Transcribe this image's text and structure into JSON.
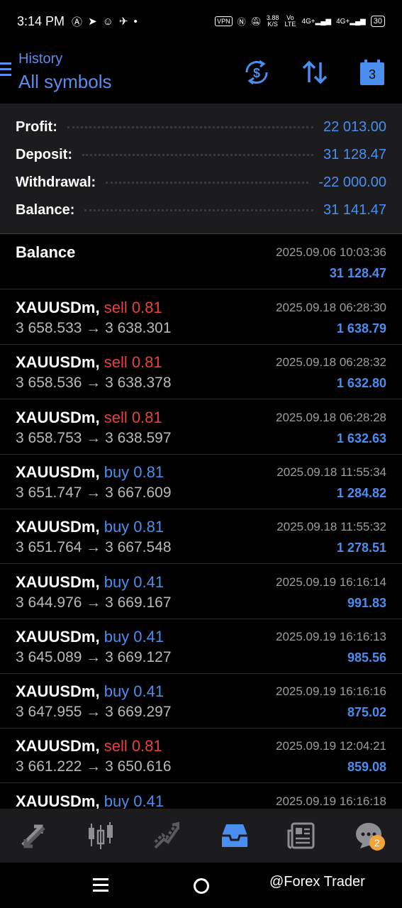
{
  "status_bar": {
    "time": "3:14 PM",
    "vpn": "VPN",
    "speed_value": "3.88",
    "speed_unit": "K/S",
    "volte": "Vo LTE",
    "net1": "4G+",
    "net2": "4G+",
    "battery": "30"
  },
  "header": {
    "subtitle": "History",
    "title": "All symbols",
    "calendar_day": "3"
  },
  "summary": [
    {
      "label": "Profit:",
      "value": "22 013.00"
    },
    {
      "label": "Deposit:",
      "value": "31 128.47"
    },
    {
      "label": "Withdrawal:",
      "value": "-22 000.00"
    },
    {
      "label": "Balance:",
      "value": "31 141.47"
    }
  ],
  "balance_entry": {
    "label": "Balance",
    "time": "2025.09.06 10:03:36",
    "amount": "31 128.47"
  },
  "deals": [
    {
      "symbol": "XAUUSDm,",
      "type": "sell 0.81",
      "side": "sell",
      "prices": "3 658.533 → 3 638.301",
      "time": "2025.09.18 06:28:30",
      "profit": "1 638.79"
    },
    {
      "symbol": "XAUUSDm,",
      "type": "sell 0.81",
      "side": "sell",
      "prices": "3 658.536 → 3 638.378",
      "time": "2025.09.18 06:28:32",
      "profit": "1 632.80"
    },
    {
      "symbol": "XAUUSDm,",
      "type": "sell 0.81",
      "side": "sell",
      "prices": "3 658.753 → 3 638.597",
      "time": "2025.09.18 06:28:28",
      "profit": "1 632.63"
    },
    {
      "symbol": "XAUUSDm,",
      "type": "buy 0.81",
      "side": "buy",
      "prices": "3 651.747 → 3 667.609",
      "time": "2025.09.18 11:55:34",
      "profit": "1 284.82"
    },
    {
      "symbol": "XAUUSDm,",
      "type": "buy 0.81",
      "side": "buy",
      "prices": "3 651.764 → 3 667.548",
      "time": "2025.09.18 11:55:32",
      "profit": "1 278.51"
    },
    {
      "symbol": "XAUUSDm,",
      "type": "buy 0.41",
      "side": "buy",
      "prices": "3 644.976 → 3 669.167",
      "time": "2025.09.19 16:16:14",
      "profit": "991.83"
    },
    {
      "symbol": "XAUUSDm,",
      "type": "buy 0.41",
      "side": "buy",
      "prices": "3 645.089 → 3 669.127",
      "time": "2025.09.19 16:16:13",
      "profit": "985.56"
    },
    {
      "symbol": "XAUUSDm,",
      "type": "buy 0.41",
      "side": "buy",
      "prices": "3 647.955 → 3 669.297",
      "time": "2025.09.19 16:16:16",
      "profit": "875.02"
    },
    {
      "symbol": "XAUUSDm,",
      "type": "sell 0.81",
      "side": "sell",
      "prices": "3 661.222 → 3 650.616",
      "time": "2025.09.19 12:04:21",
      "profit": "859.08"
    },
    {
      "symbol": "XAUUSDm,",
      "type": "buy 0.41",
      "side": "buy",
      "prices": "",
      "time": "2025.09.19 16:16:18",
      "profit": ""
    }
  ],
  "tabbar": {
    "icons": [
      "quotes-icon",
      "chart-icon",
      "trade-icon",
      "history-icon",
      "news-icon",
      "messages-icon"
    ],
    "active": "history-icon",
    "messages_badge": "2"
  },
  "watermark": "@Forex Trader",
  "colors": {
    "accent": "#4a8ef0",
    "sell": "#e8413f",
    "badge": "#f2a33a"
  }
}
